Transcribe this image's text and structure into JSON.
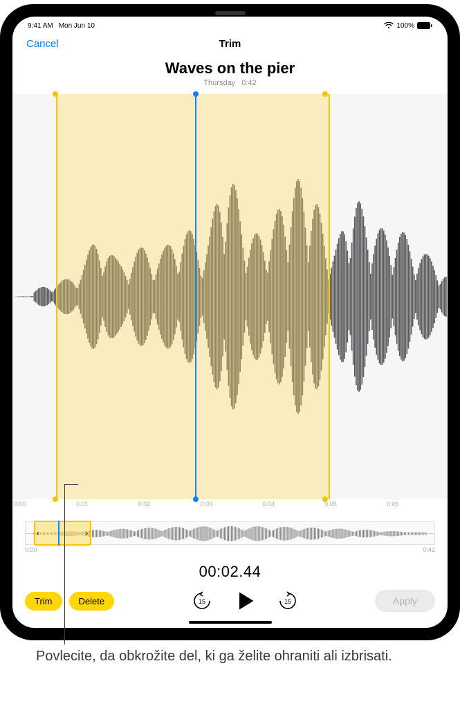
{
  "status": {
    "time": "9:41 AM",
    "date": "Mon Jun 10",
    "battery": "100%"
  },
  "nav": {
    "cancel": "Cancel",
    "title": "Trim",
    "more": "○○○"
  },
  "recording": {
    "title": "Waves on the pier",
    "day": "Thursday",
    "duration": "0:42"
  },
  "ruler": {
    "ticks": [
      "0:00",
      "0:01",
      "0:02",
      "0:03",
      "0:04",
      "0:05",
      "0:06"
    ]
  },
  "overview": {
    "start": "0:00",
    "end": "0:42"
  },
  "selection": {
    "start_pct": 10,
    "end_pct": 73,
    "playhead_pct": 42,
    "ov_start_pct": 2,
    "ov_end_pct": 16,
    "ov_play_pct": 8,
    "left_glyph": "‹",
    "right_glyph": "›"
  },
  "timecode": "00:02.44",
  "buttons": {
    "trim": "Trim",
    "delete": "Delete",
    "apply": "Apply",
    "skip_back_num": "15",
    "skip_fwd_num": "15"
  },
  "callout": "Povlecite, da obkrožite del, ki ga želite ohraniti ali izbrisati."
}
